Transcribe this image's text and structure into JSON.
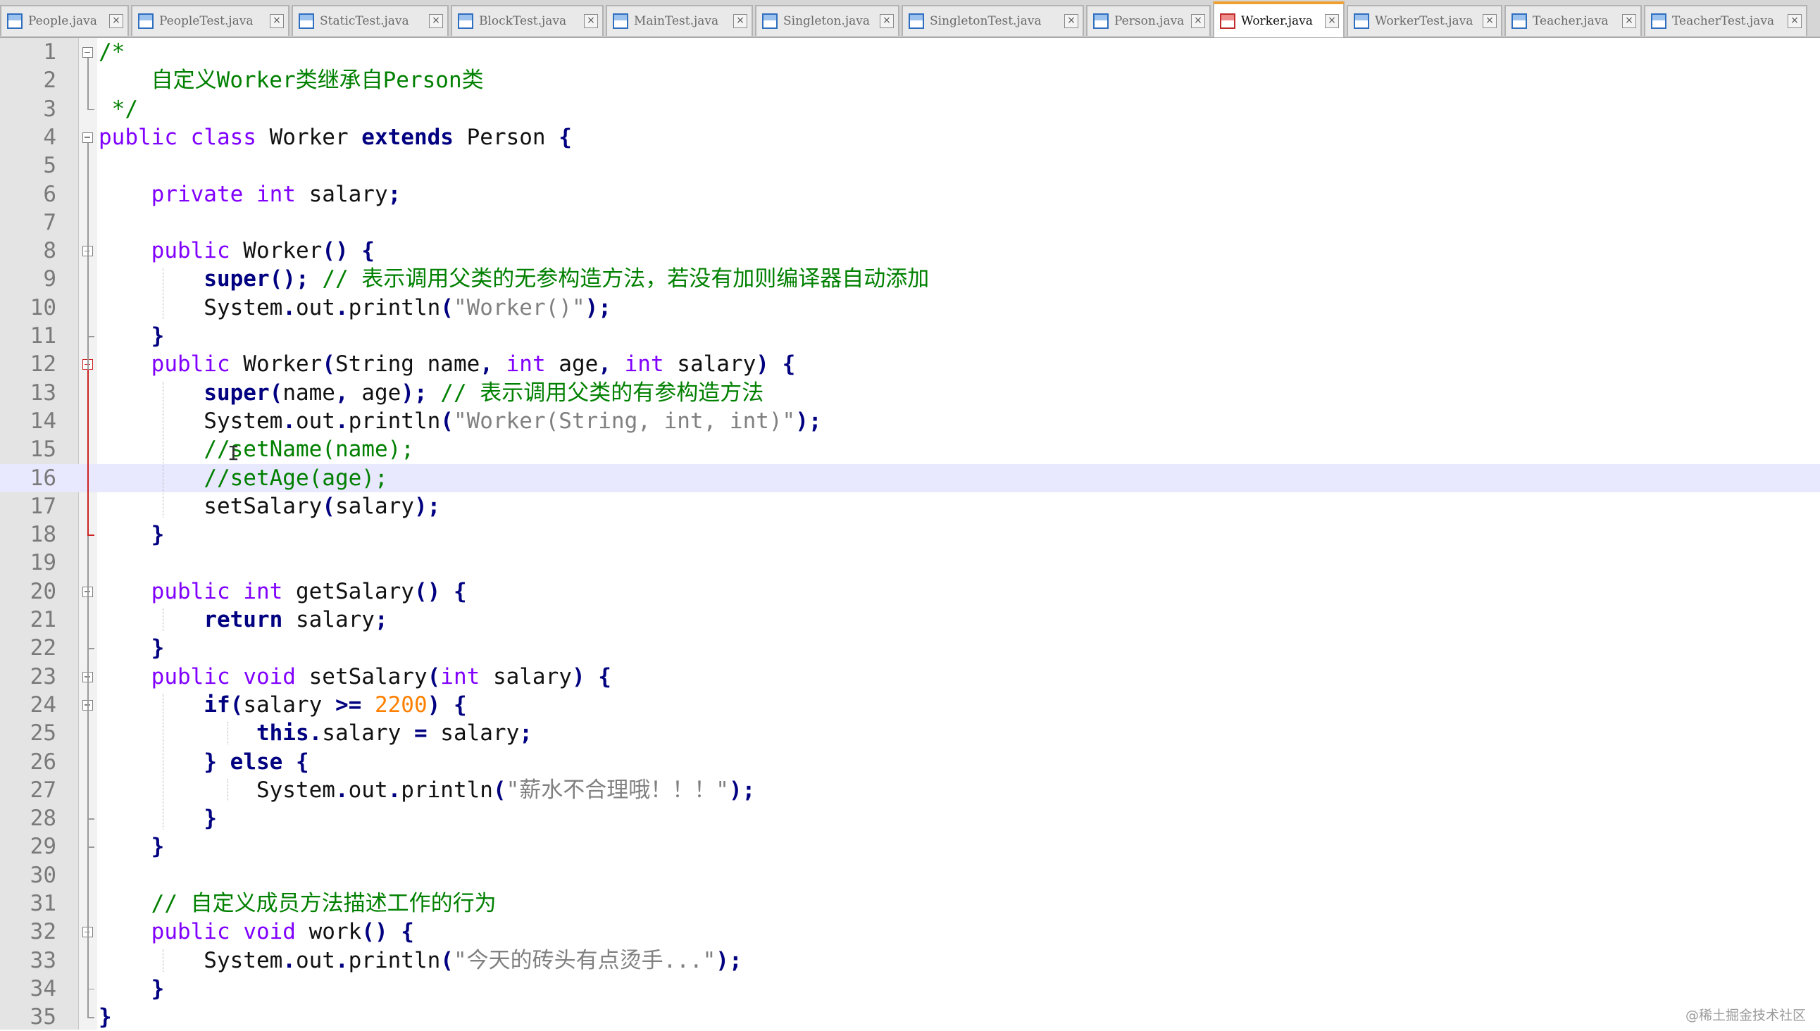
{
  "tabs": [
    {
      "label": "People.java",
      "active": false
    },
    {
      "label": "PeopleTest.java",
      "active": false
    },
    {
      "label": "StaticTest.java",
      "active": false
    },
    {
      "label": "BlockTest.java",
      "active": false
    },
    {
      "label": "MainTest.java",
      "active": false
    },
    {
      "label": "Singleton.java",
      "active": false
    },
    {
      "label": "SingletonTest.java",
      "active": false
    },
    {
      "label": "Person.java",
      "active": false
    },
    {
      "label": "Worker.java",
      "active": true
    },
    {
      "label": "WorkerTest.java",
      "active": false
    },
    {
      "label": "Teacher.java",
      "active": false
    },
    {
      "label": "TeacherTest.java",
      "active": false
    }
  ],
  "tab_close_glyph": "×",
  "editor": {
    "highlighted_line": 16,
    "line_numbers": [
      "1",
      "2",
      "3",
      "4",
      "5",
      "6",
      "7",
      "8",
      "9",
      "10",
      "11",
      "12",
      "13",
      "14",
      "15",
      "16",
      "17",
      "18",
      "19",
      "20",
      "21",
      "22",
      "23",
      "24",
      "25",
      "26",
      "27",
      "28",
      "29",
      "30",
      "31",
      "32",
      "33",
      "34",
      "35"
    ],
    "lines": [
      [
        [
          "cm",
          "/*"
        ]
      ],
      [
        [
          "cm",
          "    自定义Worker类继承自Person类"
        ]
      ],
      [
        [
          "cm",
          " */"
        ]
      ],
      [
        [
          "ty",
          "public"
        ],
        [
          "tx",
          " "
        ],
        [
          "ty",
          "class"
        ],
        [
          "tx",
          " Worker "
        ],
        [
          "kw",
          "extends"
        ],
        [
          "tx",
          " Person "
        ],
        [
          "op",
          "{"
        ]
      ],
      [],
      [
        [
          "tx",
          "    "
        ],
        [
          "ty",
          "private"
        ],
        [
          "tx",
          " "
        ],
        [
          "ty",
          "int"
        ],
        [
          "tx",
          " salary"
        ],
        [
          "op",
          ";"
        ]
      ],
      [],
      [
        [
          "tx",
          "    "
        ],
        [
          "ty",
          "public"
        ],
        [
          "tx",
          " Worker"
        ],
        [
          "op",
          "()"
        ],
        [
          "tx",
          " "
        ],
        [
          "op",
          "{"
        ]
      ],
      [
        [
          "tx",
          "        "
        ],
        [
          "kw",
          "super"
        ],
        [
          "op",
          "();"
        ],
        [
          "tx",
          " "
        ],
        [
          "cm",
          "// 表示调用父类的无参构造方法，若没有加则编译器自动添加"
        ]
      ],
      [
        [
          "tx",
          "        System"
        ],
        [
          "op",
          "."
        ],
        [
          "tx",
          "out"
        ],
        [
          "op",
          "."
        ],
        [
          "tx",
          "println"
        ],
        [
          "op",
          "("
        ],
        [
          "st",
          "\"Worker()\""
        ],
        [
          "op",
          ");"
        ]
      ],
      [
        [
          "tx",
          "    "
        ],
        [
          "op",
          "}"
        ]
      ],
      [
        [
          "tx",
          "    "
        ],
        [
          "ty",
          "public"
        ],
        [
          "tx",
          " Worker"
        ],
        [
          "op",
          "("
        ],
        [
          "tx",
          "String name"
        ],
        [
          "op",
          ","
        ],
        [
          "tx",
          " "
        ],
        [
          "ty",
          "int"
        ],
        [
          "tx",
          " age"
        ],
        [
          "op",
          ","
        ],
        [
          "tx",
          " "
        ],
        [
          "ty",
          "int"
        ],
        [
          "tx",
          " salary"
        ],
        [
          "op",
          ")"
        ],
        [
          "tx",
          " "
        ],
        [
          "op",
          "{"
        ]
      ],
      [
        [
          "tx",
          "        "
        ],
        [
          "kw",
          "super"
        ],
        [
          "op",
          "("
        ],
        [
          "tx",
          "name"
        ],
        [
          "op",
          ","
        ],
        [
          "tx",
          " age"
        ],
        [
          "op",
          ");"
        ],
        [
          "tx",
          " "
        ],
        [
          "cm",
          "// 表示调用父类的有参构造方法"
        ]
      ],
      [
        [
          "tx",
          "        System"
        ],
        [
          "op",
          "."
        ],
        [
          "tx",
          "out"
        ],
        [
          "op",
          "."
        ],
        [
          "tx",
          "println"
        ],
        [
          "op",
          "("
        ],
        [
          "st",
          "\"Worker(String, int, int)\""
        ],
        [
          "op",
          ");"
        ]
      ],
      [
        [
          "tx",
          "        "
        ],
        [
          "cm",
          "//setName(name);"
        ]
      ],
      [
        [
          "tx",
          "        "
        ],
        [
          "cm",
          "//setAge(age);"
        ]
      ],
      [
        [
          "tx",
          "        setSalary"
        ],
        [
          "op",
          "("
        ],
        [
          "tx",
          "salary"
        ],
        [
          "op",
          ");"
        ]
      ],
      [
        [
          "tx",
          "    "
        ],
        [
          "op",
          "}"
        ]
      ],
      [],
      [
        [
          "tx",
          "    "
        ],
        [
          "ty",
          "public"
        ],
        [
          "tx",
          " "
        ],
        [
          "ty",
          "int"
        ],
        [
          "tx",
          " getSalary"
        ],
        [
          "op",
          "()"
        ],
        [
          "tx",
          " "
        ],
        [
          "op",
          "{"
        ]
      ],
      [
        [
          "tx",
          "        "
        ],
        [
          "kw",
          "return"
        ],
        [
          "tx",
          " salary"
        ],
        [
          "op",
          ";"
        ]
      ],
      [
        [
          "tx",
          "    "
        ],
        [
          "op",
          "}"
        ]
      ],
      [
        [
          "tx",
          "    "
        ],
        [
          "ty",
          "public"
        ],
        [
          "tx",
          " "
        ],
        [
          "ty",
          "void"
        ],
        [
          "tx",
          " setSalary"
        ],
        [
          "op",
          "("
        ],
        [
          "ty",
          "int"
        ],
        [
          "tx",
          " salary"
        ],
        [
          "op",
          ")"
        ],
        [
          "tx",
          " "
        ],
        [
          "op",
          "{"
        ]
      ],
      [
        [
          "tx",
          "        "
        ],
        [
          "kw",
          "if"
        ],
        [
          "op",
          "("
        ],
        [
          "tx",
          "salary "
        ],
        [
          "op",
          ">="
        ],
        [
          "tx",
          " "
        ],
        [
          "nm",
          "2200"
        ],
        [
          "op",
          ")"
        ],
        [
          "tx",
          " "
        ],
        [
          "op",
          "{"
        ]
      ],
      [
        [
          "tx",
          "            "
        ],
        [
          "kw",
          "this"
        ],
        [
          "op",
          "."
        ],
        [
          "tx",
          "salary "
        ],
        [
          "op",
          "="
        ],
        [
          "tx",
          " salary"
        ],
        [
          "op",
          ";"
        ]
      ],
      [
        [
          "tx",
          "        "
        ],
        [
          "op",
          "}"
        ],
        [
          "tx",
          " "
        ],
        [
          "kw",
          "else"
        ],
        [
          "tx",
          " "
        ],
        [
          "op",
          "{"
        ]
      ],
      [
        [
          "tx",
          "            System"
        ],
        [
          "op",
          "."
        ],
        [
          "tx",
          "out"
        ],
        [
          "op",
          "."
        ],
        [
          "tx",
          "println"
        ],
        [
          "op",
          "("
        ],
        [
          "st",
          "\"薪水不合理哦！！！\""
        ],
        [
          "op",
          ");"
        ]
      ],
      [
        [
          "tx",
          "        "
        ],
        [
          "op",
          "}"
        ]
      ],
      [
        [
          "tx",
          "    "
        ],
        [
          "op",
          "}"
        ]
      ],
      [],
      [
        [
          "tx",
          "    "
        ],
        [
          "cm",
          "// 自定义成员方法描述工作的行为"
        ]
      ],
      [
        [
          "tx",
          "    "
        ],
        [
          "ty",
          "public"
        ],
        [
          "tx",
          " "
        ],
        [
          "ty",
          "void"
        ],
        [
          "tx",
          " work"
        ],
        [
          "op",
          "()"
        ],
        [
          "tx",
          " "
        ],
        [
          "op",
          "{"
        ]
      ],
      [
        [
          "tx",
          "        System"
        ],
        [
          "op",
          "."
        ],
        [
          "tx",
          "out"
        ],
        [
          "op",
          "."
        ],
        [
          "tx",
          "println"
        ],
        [
          "op",
          "("
        ],
        [
          "st",
          "\"今天的砖头有点烫手...\""
        ],
        [
          "op",
          ");"
        ]
      ],
      [
        [
          "tx",
          "    "
        ],
        [
          "op",
          "}"
        ]
      ],
      [
        [
          "op",
          "}"
        ]
      ]
    ]
  },
  "watermark": "@稀土掘金技术社区",
  "colors": {
    "keyword": "#000080",
    "type": "#8000ff",
    "comment": "#008000",
    "string": "#808080",
    "number": "#ff8000",
    "active_tab_accent": "#f0a030",
    "current_line": "#e8e8ff"
  },
  "icons": {
    "tab_file": "java-file-icon",
    "tab_close": "close-icon",
    "fold_marker": "fold-minus-icon",
    "text_cursor": "ibeam-cursor-icon"
  }
}
